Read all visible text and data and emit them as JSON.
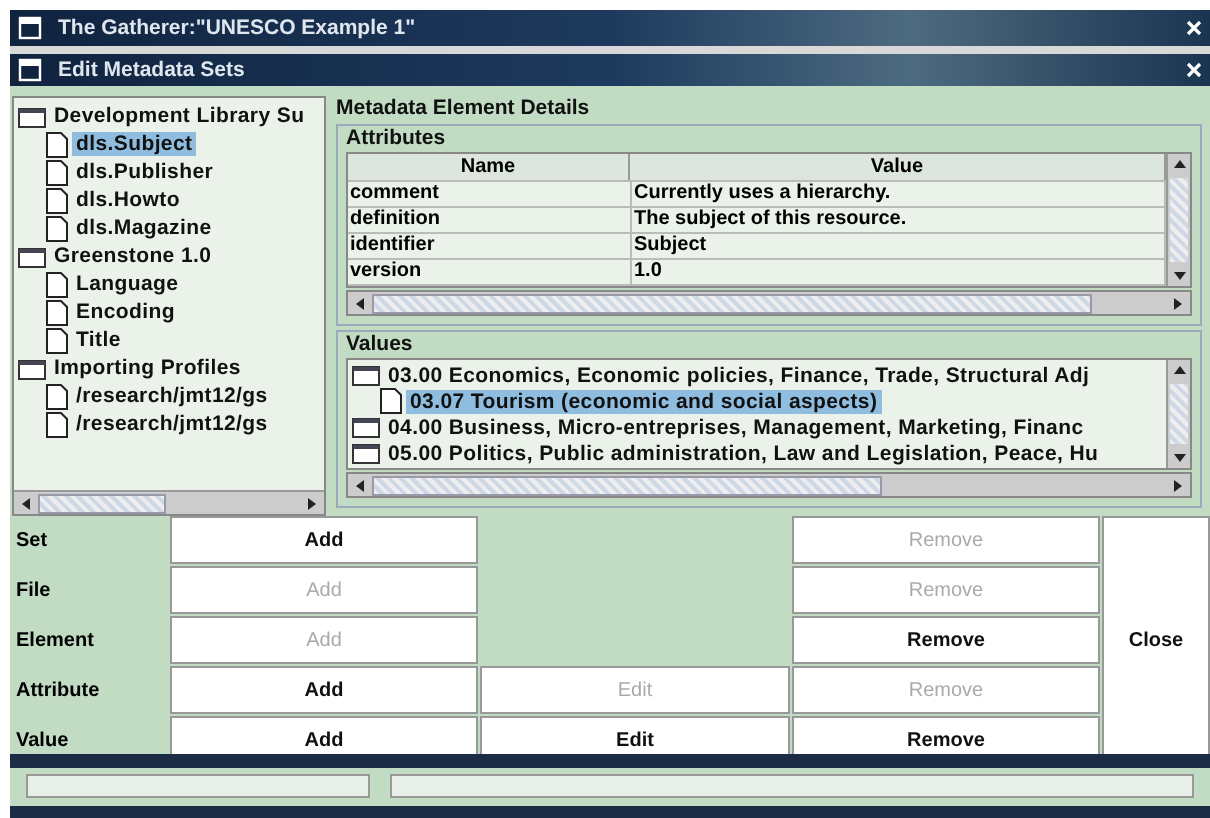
{
  "window": {
    "title": "The Gatherer:\"UNESCO Example 1\""
  },
  "dialog": {
    "title": "Edit Metadata Sets"
  },
  "sets_tree": [
    {
      "label": "Development Library Su",
      "selected": false,
      "children": [
        {
          "label": "dls.Subject",
          "selected": true
        },
        {
          "label": "dls.Publisher",
          "selected": false
        },
        {
          "label": "dls.Howto",
          "selected": false
        },
        {
          "label": "dls.Magazine",
          "selected": false
        }
      ]
    },
    {
      "label": "Greenstone 1.0",
      "selected": false,
      "children": [
        {
          "label": "Language",
          "selected": false
        },
        {
          "label": "Encoding",
          "selected": false
        },
        {
          "label": "Title",
          "selected": false
        }
      ]
    },
    {
      "label": "Importing Profiles",
      "selected": false,
      "children": [
        {
          "label": "/research/jmt12/gs",
          "selected": false
        },
        {
          "label": "/research/jmt12/gs",
          "selected": false
        }
      ]
    }
  ],
  "details": {
    "title": "Metadata Element Details",
    "attributes": {
      "title": "Attributes",
      "columns": [
        "Name",
        "Value"
      ],
      "rows": [
        [
          "comment",
          "Currently uses a hierarchy."
        ],
        [
          "definition",
          "The subject of this resource."
        ],
        [
          "identifier",
          "Subject"
        ],
        [
          "version",
          "1.0"
        ]
      ]
    },
    "values": {
      "title": "Values",
      "items": [
        {
          "label": "03.00 Economics, Economic policies, Finance, Trade, Structural Adj",
          "selected": false,
          "children": [
            {
              "label": "03.07 Tourism (economic and social aspects)",
              "selected": true
            }
          ]
        },
        {
          "label": "04.00 Business, Micro-entreprises, Management, Marketing, Financ",
          "selected": false
        },
        {
          "label": "05.00 Politics, Public administration, Law and Legislation, Peace, Hu",
          "selected": false
        }
      ]
    }
  },
  "button_rows": [
    {
      "label": "Set",
      "cells": [
        {
          "kind": "button",
          "label": "Add",
          "disabled": false
        },
        {
          "kind": "gap"
        },
        {
          "kind": "button",
          "label": "Remove",
          "disabled": true
        }
      ]
    },
    {
      "label": "File",
      "cells": [
        {
          "kind": "button",
          "label": "Add",
          "disabled": true
        },
        {
          "kind": "gap"
        },
        {
          "kind": "button",
          "label": "Remove",
          "disabled": true
        }
      ]
    },
    {
      "label": "Element",
      "cells": [
        {
          "kind": "button",
          "label": "Add",
          "disabled": true
        },
        {
          "kind": "gap"
        },
        {
          "kind": "button",
          "label": "Remove",
          "disabled": false
        }
      ]
    },
    {
      "label": "Attribute",
      "cells": [
        {
          "kind": "button",
          "label": "Add",
          "disabled": false
        },
        {
          "kind": "button",
          "label": "Edit",
          "disabled": true
        },
        {
          "kind": "button",
          "label": "Remove",
          "disabled": true
        }
      ]
    },
    {
      "label": "Value",
      "cells": [
        {
          "kind": "button",
          "label": "Add",
          "disabled": false
        },
        {
          "kind": "button",
          "label": "Edit",
          "disabled": false
        },
        {
          "kind": "button",
          "label": "Remove",
          "disabled": false
        }
      ]
    }
  ],
  "close_button": "Close"
}
